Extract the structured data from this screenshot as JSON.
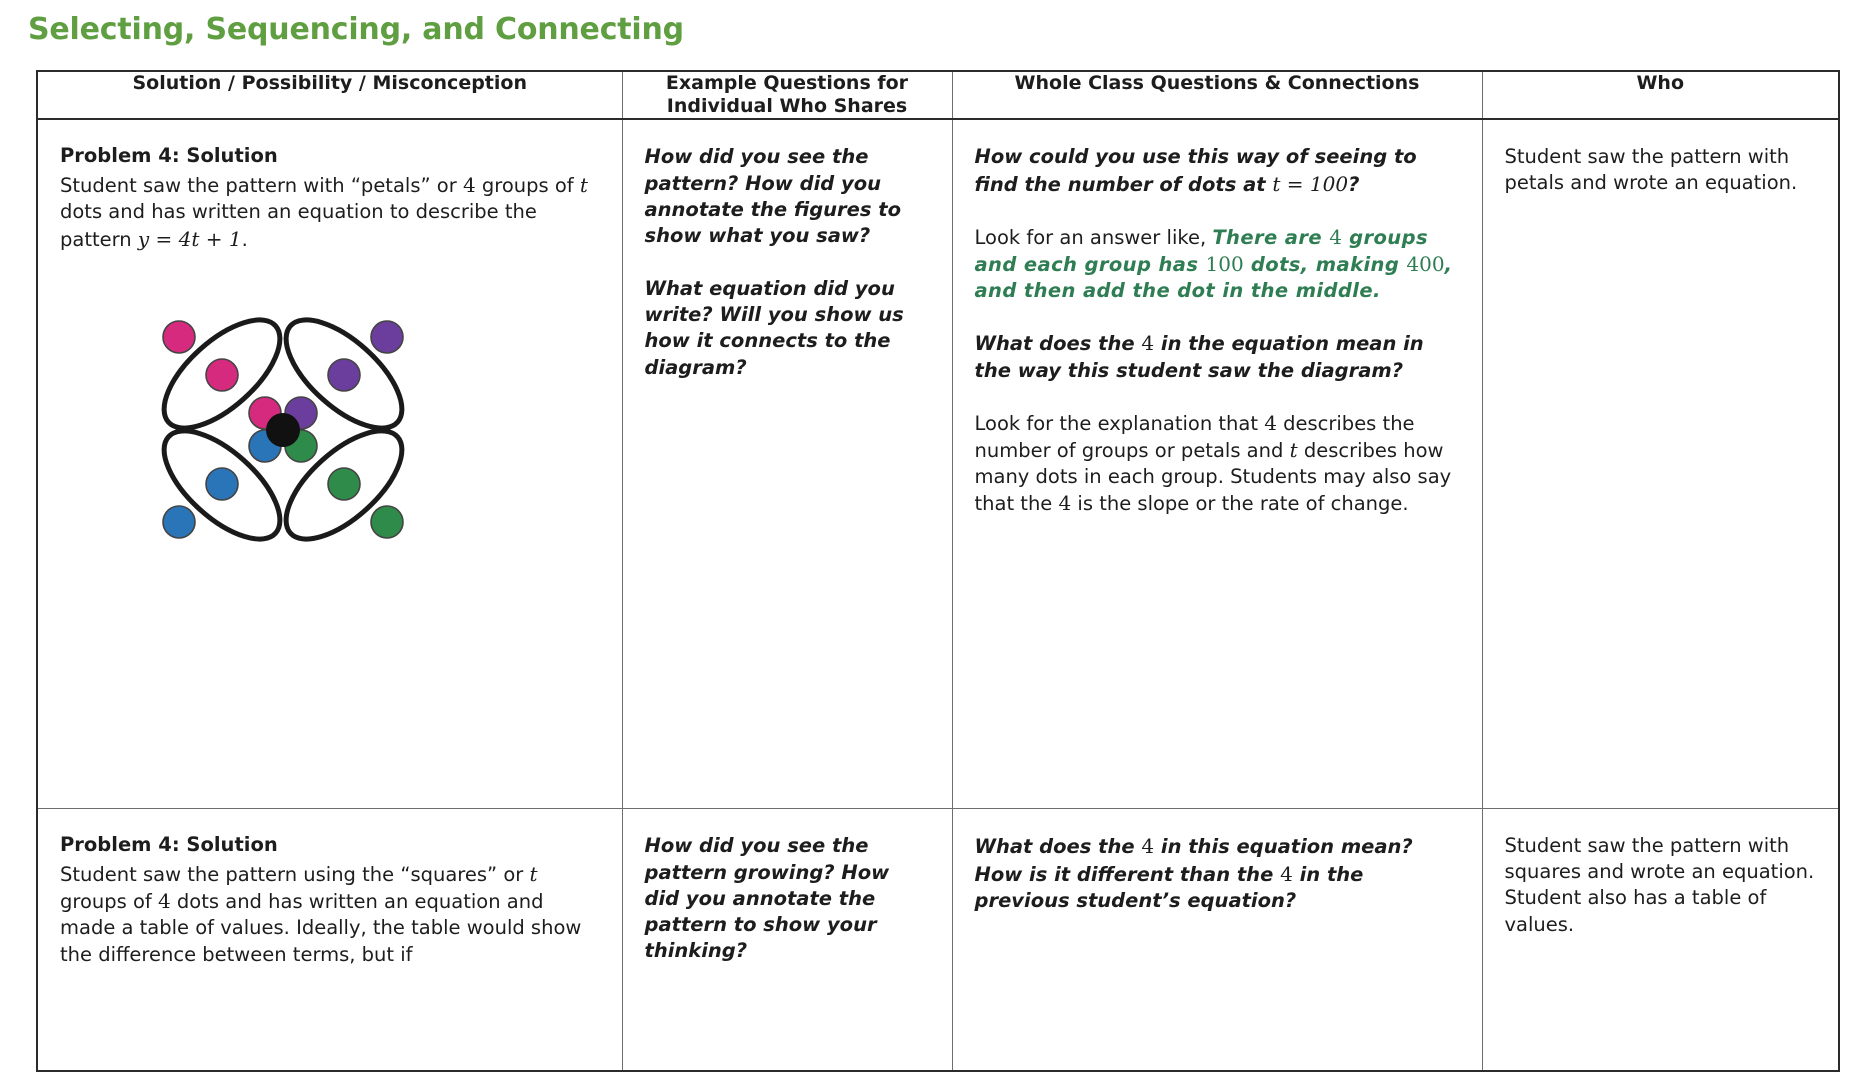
{
  "title": "Selecting, Sequencing, and Connecting",
  "title_color": "#5f9e41",
  "accent_green": "#2f7d52",
  "table": {
    "headers": [
      "Solution / Possibility / Misconception",
      "Example Questions for Individual Who Shares",
      "Whole Class Questions & Connections",
      "Who"
    ],
    "rows": [
      {
        "col1": {
          "heading": "Problem 4: Solution",
          "line1_a": "Student saw the pattern with “petals” or ",
          "line1_math": "4",
          "line2_a": " groups of ",
          "line2_math": "t",
          "line2_b": " dots and has written an equation to describe the pattern ",
          "equation": "y = 4t + 1",
          "line2_end": ".",
          "diagram": {
            "name": "four-petal-dot-diagram",
            "petals": 4,
            "dots_per_petal": 3,
            "center_dot": 1,
            "petal_colors": [
              "#d62a7e",
              "#6b3e9e",
              "#2a74b8",
              "#2e8b49"
            ],
            "center_color": "#1a1a1a"
          }
        },
        "col2": {
          "q1": "How did you see the pattern? How did you annotate the figures to show what you saw?",
          "q2": "What equation did you write? Will you show us how it connects to the diagram?"
        },
        "col3": {
          "q1_a": "How could you use this way of seeing to find the number of dots at ",
          "q1_math": "t = 100",
          "q1_end": "?",
          "p1_prefix": "Look for an answer like, ",
          "p1_green_a": "There are ",
          "p1_green_n1": "4",
          "p1_green_b": " groups and each group has ",
          "p1_green_n2": "100",
          "p1_green_c": " dots, making ",
          "p1_green_n3": "400",
          "p1_green_d": ", and then add the dot in the middle.",
          "q2_a": "What does the ",
          "q2_math": "4",
          "q2_b": " in the equation mean in the way this student saw the diagram?",
          "p2_a": "Look for the explanation that ",
          "p2_m1": "4",
          "p2_b": " describes the number of groups or petals and ",
          "p2_m2": "t",
          "p2_c": " describes how many dots in each group. Students may also say that the ",
          "p2_m3": "4",
          "p2_d": " is the slope or the rate of change."
        },
        "col4": {
          "text": "Student saw the pattern with petals and wrote an equation."
        }
      },
      {
        "col1": {
          "heading": "Problem 4: Solution",
          "line1_a": "Student saw the pattern using the “squares” or ",
          "line1_math": "t",
          "line2_a": " groups of ",
          "line2_math": "4",
          "line2_b": " dots and has written an equation and made a table of values. Ideally, the table would show the difference between terms, but if"
        },
        "col2": {
          "q1": "How did you see the pattern growing? How did you annotate the pattern to show your thinking?"
        },
        "col3": {
          "q1_a": "What does the ",
          "q1_m1": "4",
          "q1_b": " in this equation mean? How is it different than the ",
          "q1_m2": "4",
          "q1_c": " in the previous student’s equation?"
        },
        "col4": {
          "text": "Student saw the pattern with squares and wrote an equation. Student also has a table of values."
        }
      }
    ]
  }
}
